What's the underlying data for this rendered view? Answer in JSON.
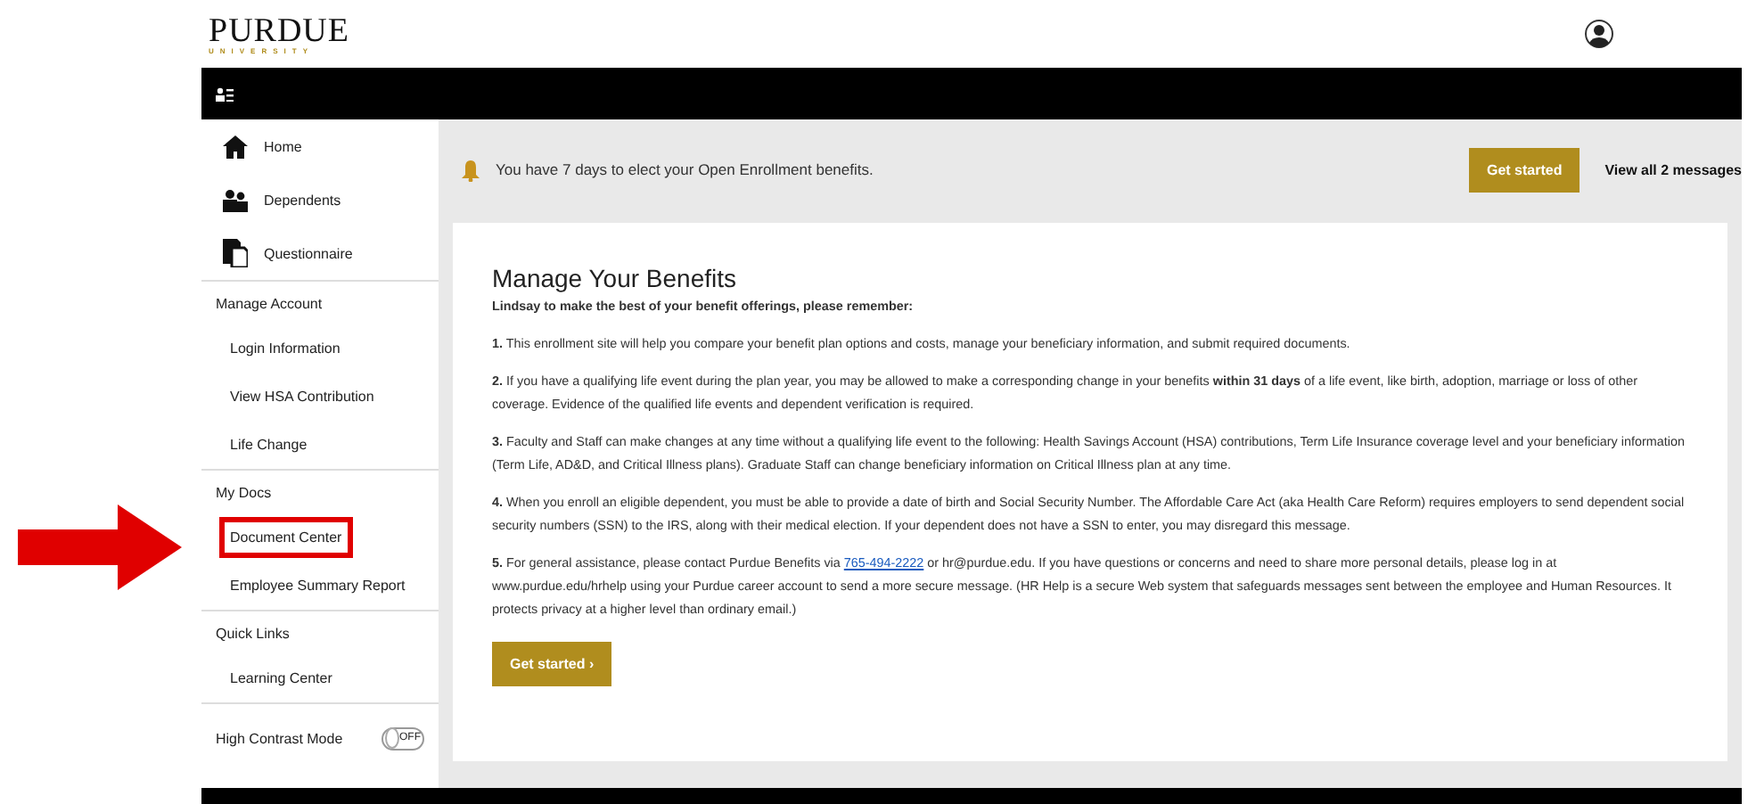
{
  "header": {
    "logo": "PURDUE",
    "logo_sub": "UNIVERSITY"
  },
  "sidebar": {
    "items": [
      {
        "kind": "icon",
        "label": "Home"
      },
      {
        "kind": "icon",
        "label": "Dependents"
      },
      {
        "kind": "icon",
        "label": "Questionnaire"
      },
      {
        "kind": "heading",
        "label": "Manage Account"
      },
      {
        "kind": "link",
        "label": "Login Information",
        "highlighted": false
      },
      {
        "kind": "link",
        "label": "View HSA Contribution",
        "highlighted": false
      },
      {
        "kind": "link",
        "label": "Life Change",
        "highlighted": false
      },
      {
        "kind": "heading",
        "label": "My Docs"
      },
      {
        "kind": "link",
        "label": "Document Center",
        "highlighted": true
      },
      {
        "kind": "link",
        "label": "Employee Summary Report",
        "highlighted": false
      },
      {
        "kind": "heading",
        "label": "Quick Links"
      },
      {
        "kind": "link",
        "label": "Learning Center",
        "highlighted": false
      },
      {
        "kind": "toggle",
        "label": "High Contrast Mode",
        "on": false,
        "state_label": "OFF"
      }
    ]
  },
  "notification": {
    "text": "You have 7 days to elect your Open Enrollment benefits.",
    "button": "Get started",
    "link": "View all 2 messages"
  },
  "card": {
    "title": "Manage Your Benefits",
    "intro": "Lindsay to make the best of your benefit offerings, please remember:",
    "paragraphs": [
      {
        "text": "**1.** This enrollment site will help you compare your benefit plan options and costs, manage your beneficiary information, and submit required documents."
      },
      {
        "text": "**2.** If you have a qualifying life event during the plan year, you may be allowed to make a corresponding change in your benefits **within 31 days** of a life event, like birth, adoption, marriage or loss of other coverage. Evidence of the qualified life events and dependent verification is required."
      },
      {
        "text": "**3.** Faculty and Staff can make changes at any time without a qualifying life event to the following: Health Savings Account (HSA) contributions, Term Life Insurance coverage level and your beneficiary information (Term Life, AD&D, and Critical Illness plans). Graduate Staff can change beneficiary information on Critical Illness plan at any time."
      },
      {
        "text": "**4.** When you enroll an eligible dependent, you must be able to provide a date of birth and Social Security Number. The Affordable Care Act (aka Health Care Reform) requires employers to send dependent social security numbers (SSN) to the IRS, along with their medical election. If your dependent does not have a SSN to enter, you may disregard this message."
      },
      {
        "text": "**5.** For general assistance, please contact Purdue Benefits via",
        "link": "765-494-2222",
        "after": "or hr@purdue.edu. If you have questions or concerns and need to share more personal details, please log in at www.purdue.edu/hrhelp using your Purdue career account to send a more secure message. (HR Help is a secure Web system that safeguards messages sent between the employee and Human Resources. It protects privacy at a higher level than ordinary email.)"
      }
    ],
    "button": "Get started",
    "button_caret": "›"
  }
}
